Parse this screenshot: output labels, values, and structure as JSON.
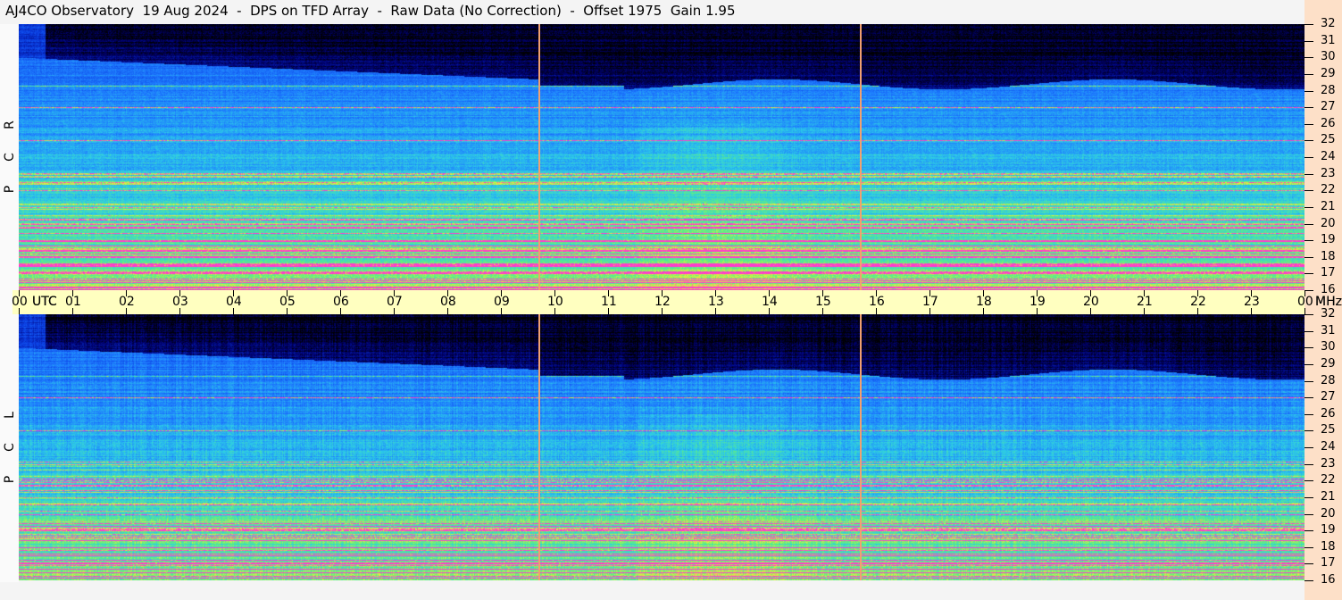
{
  "title": "AJ4CO Observatory  19 Aug 2024  -  DPS on TFD Array  -  Raw Data (No Correction)  -  Offset 1975  Gain 1.95",
  "chart_data": {
    "type": "heatmap",
    "title": "AJ4CO Observatory 19 Aug 2024 - DPS on TFD Array - Raw Data (No Correction) - Offset 1975 Gain 1.95",
    "xlabel": "UTC",
    "ylabel": "MHz",
    "xlim": [
      0,
      24
    ],
    "ylim": [
      16,
      32
    ],
    "x_ticks": [
      "00",
      "01",
      "02",
      "03",
      "04",
      "05",
      "06",
      "07",
      "08",
      "09",
      "10",
      "11",
      "12",
      "13",
      "14",
      "15",
      "16",
      "17",
      "18",
      "19",
      "20",
      "21",
      "22",
      "23",
      "00"
    ],
    "x_unit_label": "UTC",
    "y_ticks": [
      32,
      31,
      30,
      29,
      28,
      27,
      26,
      25,
      24,
      23,
      22,
      21,
      20,
      19,
      18,
      17,
      16
    ],
    "y_unit_label": "MHz",
    "panels": [
      {
        "name": "RCP",
        "letters": [
          "R",
          "C",
          "P"
        ]
      },
      {
        "name": "LCP",
        "letters": [
          "L",
          "C",
          "P"
        ]
      }
    ],
    "vertical_markers_utc": [
      9.72,
      15.72
    ],
    "interference_lines_mhz": [
      25.0,
      27.0,
      21.0,
      20.0,
      22.0,
      19.0,
      18.4,
      17.6,
      17.0,
      16.5,
      18.0,
      23.0,
      28.3
    ],
    "colorscale": [
      "#000000",
      "#000070",
      "#0a3ce0",
      "#1e7cff",
      "#2ccbe8",
      "#66f07a",
      "#e4f03c",
      "#ff3ccc"
    ]
  }
}
